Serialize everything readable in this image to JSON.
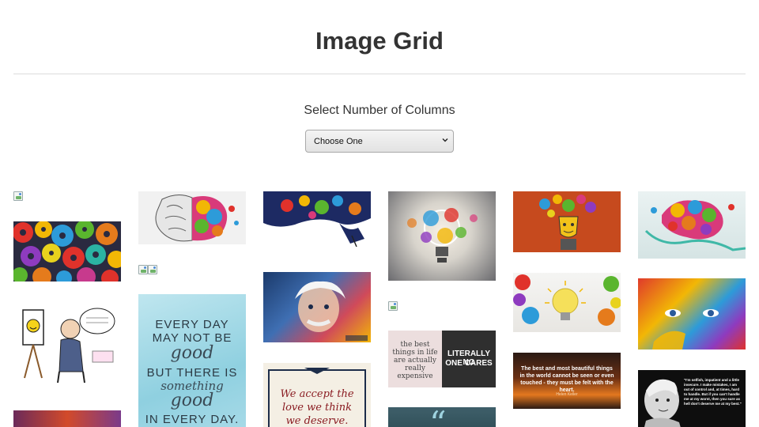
{
  "header": {
    "title": "Image Grid"
  },
  "controls": {
    "label": "Select Number of Columns",
    "select_value": "Choose One"
  },
  "gallery": {
    "quote_every_day": [
      "EVERY DAY",
      "MAY NOT BE",
      "good",
      "BUT THERE IS",
      "something",
      "good",
      "IN EVERY DAY."
    ],
    "quote_love": [
      "We accept the",
      "love we think",
      "we deserve."
    ],
    "quote_things": [
      "the best",
      "things in life",
      "are actually",
      "really",
      "expensive"
    ],
    "quote_literally": [
      "LITERALLY NO",
      "ONE CARES"
    ],
    "quote_beautiful": "The best and most beautiful things in the world cannot be seen or even touched - they must be felt with the heart.",
    "quote_beautiful_author": "Helen Keller",
    "quote_marilyn": "\"I'm selfish, impatient and a little insecure. I make mistakes, I am out of control and, at times, hard to handle. But if you can't handle me at my worst, then you sure as hell don't deserve me at my best.\"",
    "quote_mark": "“"
  }
}
